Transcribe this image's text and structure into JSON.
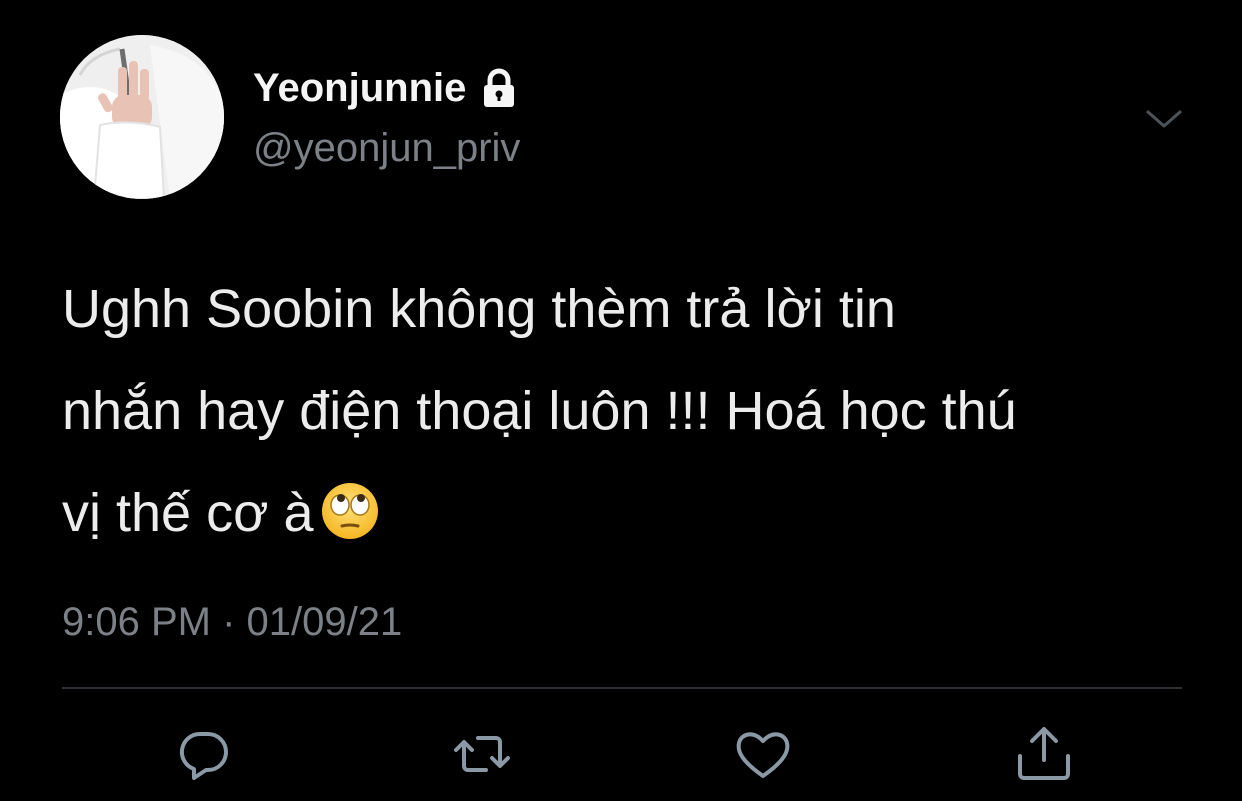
{
  "tweet": {
    "display_name": "Yeonjunnie",
    "handle": "@yeonjun_priv",
    "text_lines": [
      "Ughh Soobin không thèm trả lời tin",
      "nhắn hay điện thoại luôn !!! Hoá học thú",
      "vị thế cơ à"
    ],
    "emoji": "face-with-rolling-eyes",
    "timestamp": "9:06 PM · 01/09/21",
    "protected": true
  },
  "icons": {
    "lock": "lock-icon",
    "chevron": "chevron-down-icon",
    "reply": "reply-icon",
    "retweet": "retweet-icon",
    "like": "heart-icon",
    "share": "share-icon"
  },
  "colors": {
    "background": "#000000",
    "primary_text": "#ececec",
    "secondary_text": "#7b8187",
    "icon": "#8b98a5",
    "divider": "#2c2f33"
  }
}
